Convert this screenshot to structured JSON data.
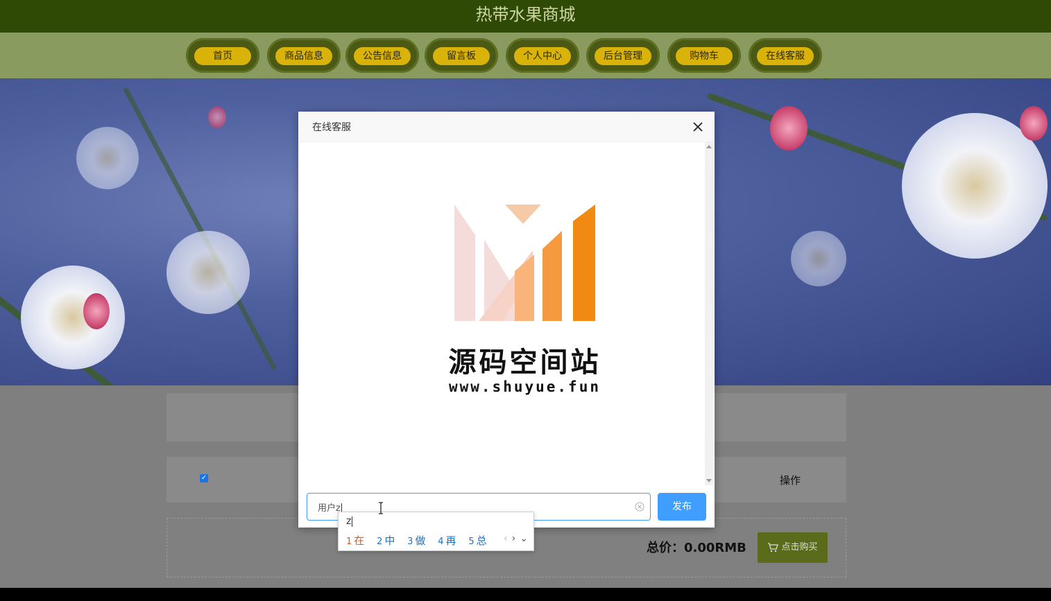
{
  "site": {
    "title": "热带水果商城"
  },
  "nav": {
    "items": [
      {
        "label": "首页"
      },
      {
        "label": "商品信息"
      },
      {
        "label": "公告信息"
      },
      {
        "label": "留言板"
      },
      {
        "label": "个人中心"
      },
      {
        "label": "后台管理"
      },
      {
        "label": "购物车"
      },
      {
        "label": "在线客服"
      }
    ]
  },
  "cart": {
    "op_header": "操作",
    "checkbox_checked": true,
    "total_label": "总价：0.00RMB",
    "buy_label": "点击购买"
  },
  "dialog": {
    "title": "在线客服",
    "logo_name": "源码空间站",
    "logo_url": "www.shuyue.fun",
    "input_value": "用户z",
    "publish_label": "发布"
  },
  "ime": {
    "composition": "z",
    "candidates": [
      {
        "num": "1",
        "text": "在"
      },
      {
        "num": "2",
        "text": "中"
      },
      {
        "num": "3",
        "text": "做"
      },
      {
        "num": "4",
        "text": "再"
      },
      {
        "num": "5",
        "text": "总"
      }
    ],
    "nav_prev": "‹",
    "nav_next": "›",
    "nav_expand": "⌄"
  },
  "colors": {
    "header": "#2f4a05",
    "nav_bg": "#8a9b5f",
    "nav_pill": "#d9b20a",
    "accent": "#409eff",
    "buy_button": "#5b6b1c",
    "logo_orange": "#f08a12"
  }
}
